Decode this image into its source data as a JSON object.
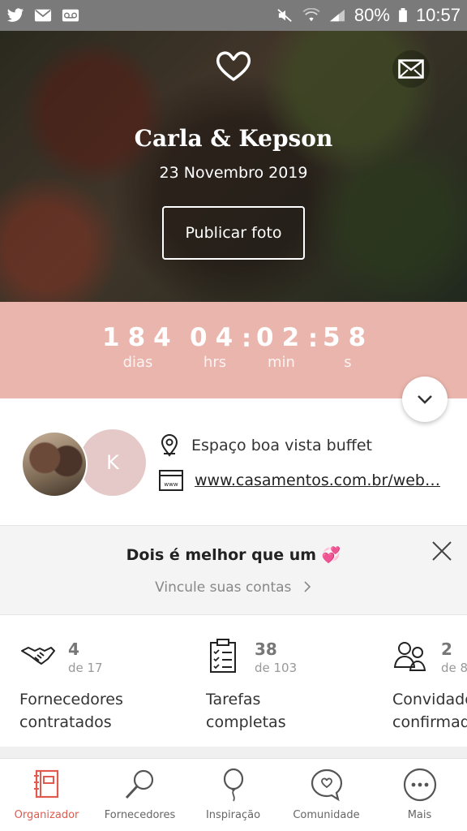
{
  "status_bar": {
    "battery": "80%",
    "time": "10:57",
    "icons": [
      "twitter-icon",
      "mail-icon",
      "voicemail-icon",
      "mute-icon",
      "wifi-icon",
      "signal-icon",
      "battery-icon"
    ]
  },
  "hero": {
    "couple_names": "Carla & Kepson",
    "date": "23 Novembro 2019",
    "publish_button": "Publicar foto"
  },
  "countdown": {
    "days": "184",
    "days_label": "dias",
    "hours": "04",
    "hours_label": "hrs",
    "minutes": "02",
    "minutes_label": "min",
    "seconds": "58",
    "seconds_label": "s"
  },
  "couple_info": {
    "avatar_initial": "K",
    "venue": "Espaço boa vista buffet",
    "website": "www.casamentos.com.br/web…"
  },
  "banner": {
    "title": "Dois é melhor que um 💞",
    "link": "Vincule suas contas"
  },
  "stats": [
    {
      "count": "4",
      "total": "de 17",
      "label": "Fornecedores\ncontratados"
    },
    {
      "count": "38",
      "total": "de 103",
      "label": "Tarefas\ncompletas"
    },
    {
      "count": "2",
      "total": "de 8",
      "label": "Convidados\nconfirmados"
    }
  ],
  "bottom_nav": {
    "items": [
      {
        "label": "Organizador"
      },
      {
        "label": "Fornecedores"
      },
      {
        "label": "Inspiração"
      },
      {
        "label": "Comunidade"
      },
      {
        "label": "Mais"
      }
    ]
  },
  "colors": {
    "accent": "#e05a4e",
    "countdown_bg": "#e9b5ad",
    "avatar_bg": "#e5c9c9"
  }
}
